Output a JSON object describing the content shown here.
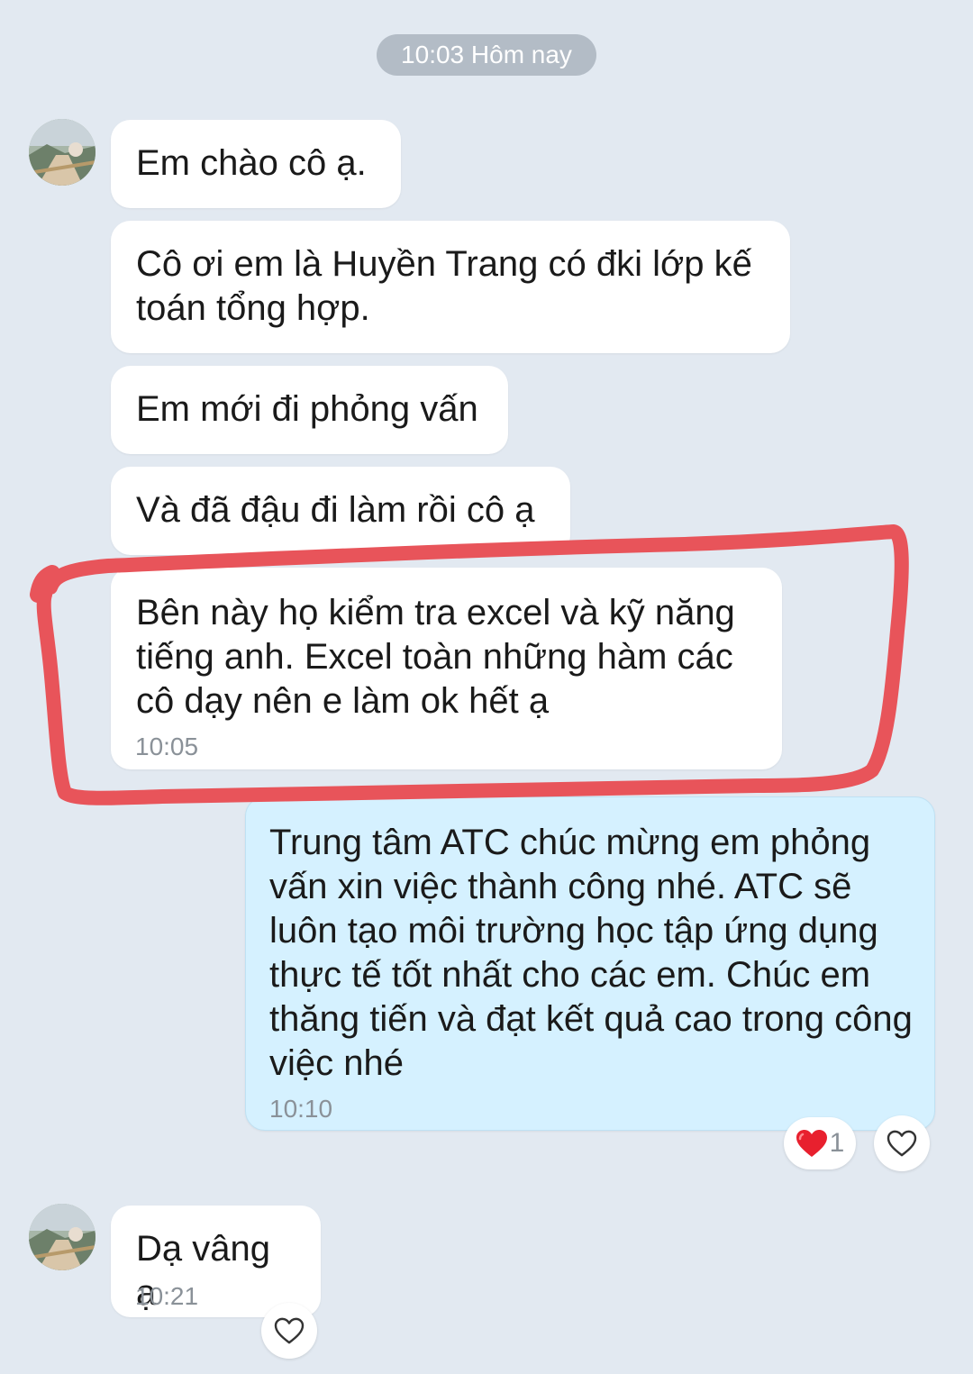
{
  "chat": {
    "date_divider": "10:03 Hôm nay",
    "messages": [
      {
        "text": "Em chào cô ạ."
      },
      {
        "text": "Cô ơi em là Huyền Trang có đki lớp kế toán tổng hợp."
      },
      {
        "text": "Em mới đi phỏng vấn"
      },
      {
        "text": "Và đã đậu đi làm rồi cô ạ"
      },
      {
        "text": "Bên này họ kiểm tra excel và kỹ năng tiếng anh. Excel toàn những hàm các cô dạy nên e làm ok hết ạ",
        "time": "10:05"
      },
      {
        "text": "Trung tâm ATC chúc mừng em phỏng vấn xin việc thành công nhé. ATC sẽ luôn tạo môi trường học tập ứng dụng thực tế tốt nhất cho các em. Chúc em thăng tiến và đạt kết quả cao trong công việc nhé",
        "time": "10:10",
        "reaction_count": "1"
      },
      {
        "text": "Dạ vâng ạ",
        "time": "10:21"
      }
    ]
  },
  "colors": {
    "background": "#e2e9f1",
    "incoming_bubble": "#ffffff",
    "outgoing_bubble": "#d5f1ff",
    "highlight_stroke": "#e8545a",
    "heart": "#e8202e"
  },
  "icons": {
    "avatar": "contact-avatar",
    "react_heart": "heart-filled-icon",
    "react_button": "heart-outline-icon"
  }
}
